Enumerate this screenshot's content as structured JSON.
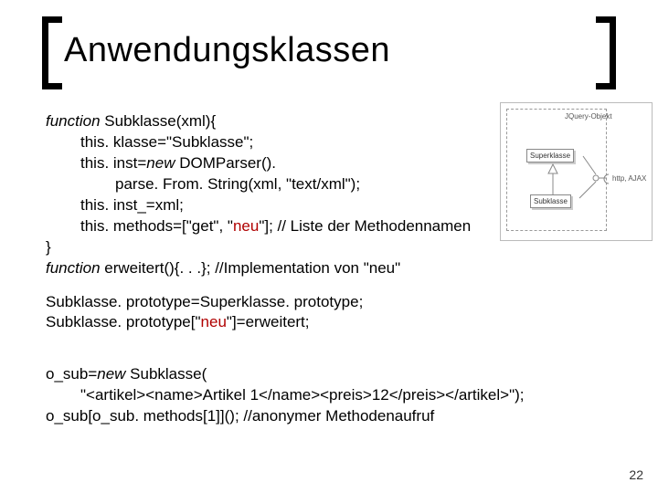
{
  "title": "Anwendungsklassen",
  "code": {
    "l1a": "function",
    "l1b": " Subklasse(xml){",
    "l2": "this. klasse=\"Subklasse\";",
    "l3a": "this. inst=",
    "l3b": "new",
    "l3c": " DOMParser().",
    "l4": "parse. From. String(xml, \"text/xml\");",
    "l5": "this. inst_=xml;",
    "l6a": "this. methods=[\"get\", \"",
    "l6b": "neu",
    "l6c": "\"]; // Liste der Methodennamen",
    "l7": "}",
    "l8a": "function",
    "l8b": " erweitert(){. . .}; //Implementation von \"neu\"",
    "p1": "Subklasse. prototype=Superklasse. prototype;",
    "p2a": "Subklasse. prototype[\"",
    "p2b": "neu",
    "p2c": "\"]=erweitert;",
    "o1a": "o_sub=",
    "o1b": "new",
    "o1c": " Subklasse(",
    "o2": "\"<artikel><name>Artikel 1</name><preis>12</preis></artikel>\");",
    "o3": "o_sub[o_sub. methods[1]](); //anonymer Methodenaufruf"
  },
  "diagram": {
    "topLabel": "JQuery-Objekt",
    "super": "Superklasse",
    "sub": "Subklasse",
    "http": "http, AJAX"
  },
  "pageNumber": "22"
}
